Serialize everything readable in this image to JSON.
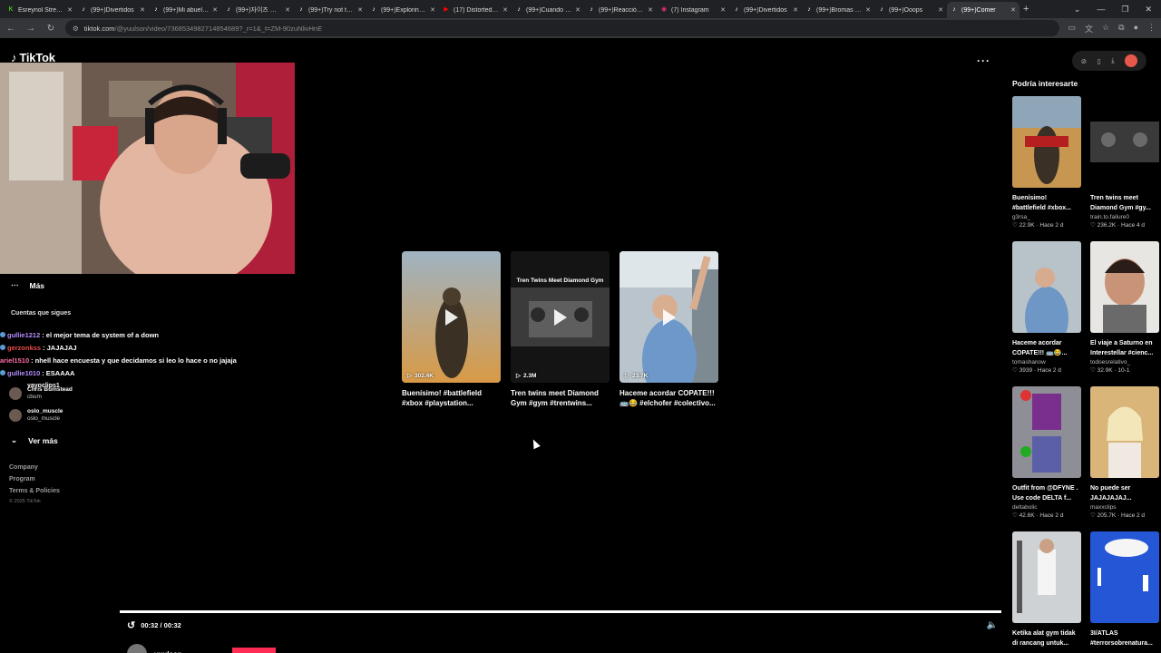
{
  "browser": {
    "tabs": [
      {
        "title": "Esreynol Stream",
        "icon": "kick-icon",
        "color": "#53fc18"
      },
      {
        "title": "(99+)Divertidos",
        "icon": "tiktok-icon",
        "color": "#ffffff"
      },
      {
        "title": "(99+)Mi abuela y",
        "icon": "tiktok-icon",
        "color": "#ffffff"
      },
      {
        "title": "(99+)자이즈 드립",
        "icon": "tiktok-icon",
        "color": "#ffffff"
      },
      {
        "title": "(99+)Try not to la",
        "icon": "tiktok-icon",
        "color": "#ffffff"
      },
      {
        "title": "(99+)Exploring M",
        "icon": "tiktok-icon",
        "color": "#ffffff"
      },
      {
        "title": "(17) Distorted M",
        "icon": "youtube-icon",
        "color": "#ff0000"
      },
      {
        "title": "(99+)Cuando el a",
        "icon": "tiktok-icon",
        "color": "#ffffff"
      },
      {
        "title": "(99+)Reacción di",
        "icon": "tiktok-icon",
        "color": "#ffffff"
      },
      {
        "title": "(7) Instagram",
        "icon": "instagram-icon",
        "color": "#e1306c"
      },
      {
        "title": "(99+)Divertidos",
        "icon": "tiktok-icon",
        "color": "#ffffff"
      },
      {
        "title": "(99+)Bromas dive",
        "icon": "tiktok-icon",
        "color": "#ffffff"
      },
      {
        "title": "(99+)Ooops",
        "icon": "tiktok-icon",
        "color": "#ffffff"
      },
      {
        "title": "(99+)Comer",
        "icon": "tiktok-icon",
        "color": "#ffffff",
        "active": true
      }
    ],
    "new_tab": "+",
    "url_host": "tiktok.com",
    "url_path": "/@yuulson/video/7368534982714854689?_r=1&_t=ZM-90zuNlivHnE"
  },
  "tiktok": {
    "logo_text": "TikTok",
    "more_label": "Más",
    "following_title": "Cuentas que sigues",
    "following": [
      {
        "name": "Chris Bumstead",
        "user": "cbum"
      },
      {
        "name": "oslo_muscle",
        "user": "oslo_muscle"
      }
    ],
    "see_more": "Ver más",
    "footer": {
      "company": "Company",
      "program": "Program",
      "terms": "Terms & Policies",
      "copyright": "© 2025 TikTok"
    }
  },
  "chat": [
    {
      "user": "gullie1212",
      "sep": ":",
      "msg": "el mejor tema de system of a down",
      "color": "purple"
    },
    {
      "user": "gerzonkss",
      "sep": ":",
      "msg": "JAJAJAJ",
      "color": "red"
    },
    {
      "user": "ariel1510",
      "sep": ":",
      "msg": "nhell hace encuesta y que decidamos si leo lo hace o no jajaja",
      "color": "pink"
    },
    {
      "user": "gullie1010",
      "sep": ":",
      "msg": "ESAAAA",
      "color": "purple"
    }
  ],
  "chat_extra": "yayoclips1",
  "center_cards": [
    {
      "views": "302.4K",
      "title": "Buenísimo! #battlefield #xbox #playstation..."
    },
    {
      "views": "2.3M",
      "title": "Tren twins meet Diamond Gym #gym #trentwins...",
      "thumb_text": "Tren Twins Meet Diamond Gym"
    },
    {
      "views": "23.7K",
      "title": "Haceme acordar COPATE!!! 🚌😂 #elchofer #colectivo..."
    }
  ],
  "recs_title": "Podría interesarte",
  "recs": [
    {
      "title": "Buenísimo! #battlefield #xbox...",
      "author": "g3rsa_",
      "likes": "22.9K",
      "age": "Hace 2 d"
    },
    {
      "title": "Tren twins meet Diamond Gym #gy...",
      "author": "train.to.failure0",
      "likes": "236.2K",
      "age": "Hace 4 d"
    },
    {
      "title": "Haceme acordar COPATE!!! 🚌😂...",
      "author": "tomashanow",
      "likes": "3939",
      "age": "Hace 2 d"
    },
    {
      "title": "El viaje a Saturno en Interestellar #cienc...",
      "author": "todoesrelativo_",
      "likes": "32.9K",
      "age": "10-1"
    },
    {
      "title": "Outfit from @DFYNE . Use code DELTA f...",
      "author": "deltabolic",
      "likes": "42.6K",
      "age": "Hace 2 d"
    },
    {
      "title": "No puede ser JAJAJAJAJ...",
      "author": "maxxclips",
      "likes": "205.7K",
      "age": "Hace 2 d"
    },
    {
      "title": "Ketika alat gym tidak di rancang untuk...",
      "author": "",
      "likes": "",
      "age": ""
    },
    {
      "title": "3I/ATLAS #terrorsobrenatura...",
      "author": "",
      "likes": "",
      "age": ""
    }
  ],
  "player": {
    "time": "00:32 / 00:32",
    "progress": 1.0,
    "author": "yuulson"
  }
}
